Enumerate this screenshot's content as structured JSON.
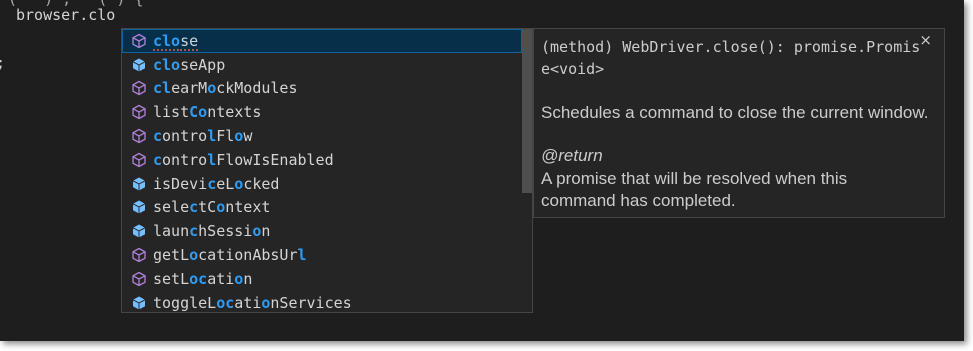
{
  "editor": {
    "code_line": "browser.clo",
    "top_fragment": "(   ) ;   ( ) {",
    "left_fragment": ";"
  },
  "suggestions": [
    {
      "icon": "method-icon",
      "parts": [
        {
          "t": "clo",
          "m": true
        },
        {
          "t": "se",
          "m": false
        }
      ]
    },
    {
      "icon": "property-icon",
      "parts": [
        {
          "t": "clo",
          "m": true
        },
        {
          "t": "seApp",
          "m": false
        }
      ]
    },
    {
      "icon": "method-icon",
      "parts": [
        {
          "t": "cl",
          "m": true
        },
        {
          "t": "earM",
          "m": false
        },
        {
          "t": "o",
          "m": true
        },
        {
          "t": "ckModules",
          "m": false
        }
      ]
    },
    {
      "icon": "method-icon",
      "parts": [
        {
          "t": "list",
          "m": false
        },
        {
          "t": "Co",
          "m": true
        },
        {
          "t": "ntexts",
          "m": false
        }
      ]
    },
    {
      "icon": "method-icon",
      "parts": [
        {
          "t": "c",
          "m": true
        },
        {
          "t": "ontro",
          "m": false
        },
        {
          "t": "l",
          "m": true
        },
        {
          "t": "Fl",
          "m": false
        },
        {
          "t": "o",
          "m": true
        },
        {
          "t": "w",
          "m": false
        }
      ]
    },
    {
      "icon": "method-icon",
      "parts": [
        {
          "t": "c",
          "m": true
        },
        {
          "t": "ontro",
          "m": false
        },
        {
          "t": "l",
          "m": true
        },
        {
          "t": "FlowIsEnabled",
          "m": false
        }
      ]
    },
    {
      "icon": "property-icon",
      "parts": [
        {
          "t": "isDevi",
          "m": false
        },
        {
          "t": "c",
          "m": true
        },
        {
          "t": "eL",
          "m": false
        },
        {
          "t": "o",
          "m": true
        },
        {
          "t": "cked",
          "m": false
        }
      ]
    },
    {
      "icon": "property-icon",
      "parts": [
        {
          "t": "sele",
          "m": false
        },
        {
          "t": "c",
          "m": true
        },
        {
          "t": "tC",
          "m": false
        },
        {
          "t": "o",
          "m": true
        },
        {
          "t": "ntext",
          "m": false
        }
      ]
    },
    {
      "icon": "property-icon",
      "parts": [
        {
          "t": "laun",
          "m": false
        },
        {
          "t": "c",
          "m": true
        },
        {
          "t": "hSessi",
          "m": false
        },
        {
          "t": "o",
          "m": true
        },
        {
          "t": "n",
          "m": false
        }
      ]
    },
    {
      "icon": "method-icon",
      "parts": [
        {
          "t": "getL",
          "m": false
        },
        {
          "t": "o",
          "m": true
        },
        {
          "t": "cationAbsUr",
          "m": false
        },
        {
          "t": "l",
          "m": true
        }
      ]
    },
    {
      "icon": "method-icon",
      "parts": [
        {
          "t": "setL",
          "m": false
        },
        {
          "t": "o",
          "m": true
        },
        {
          "t": "c",
          "m": true
        },
        {
          "t": "ati",
          "m": false
        },
        {
          "t": "o",
          "m": true
        },
        {
          "t": "n",
          "m": false
        }
      ]
    },
    {
      "icon": "property-icon",
      "parts": [
        {
          "t": "toggleL",
          "m": false
        },
        {
          "t": "o",
          "m": true
        },
        {
          "t": "c",
          "m": true
        },
        {
          "t": "ati",
          "m": false
        },
        {
          "t": "o",
          "m": true
        },
        {
          "t": "nServices",
          "m": false
        }
      ]
    }
  ],
  "selected_index": 0,
  "docs": {
    "signature": "(method) WebDriver.close(): promise.Promise<void>",
    "close_glyph": "×",
    "description": "Schedules a command to close the current window.",
    "return_tag": "@return",
    "return_text": "A promise that will be resolved when this command has completed."
  },
  "colors": {
    "method_icon": "#b180d7",
    "property_icon": "#75beff",
    "match_highlight": "#2f9cf4",
    "selected_row": "#062f4a"
  }
}
